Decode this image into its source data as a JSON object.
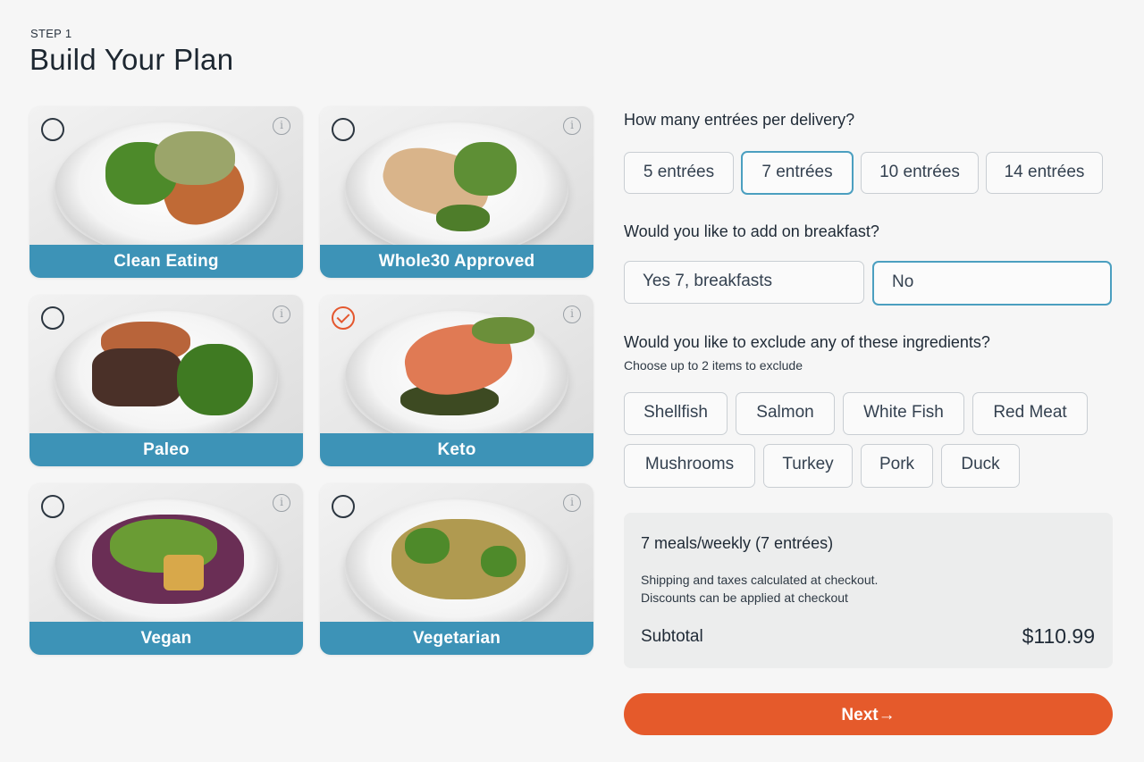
{
  "header": {
    "step": "STEP 1",
    "title": "Build Your Plan"
  },
  "plans": [
    {
      "label": "Clean Eating",
      "selected": false
    },
    {
      "label": "Whole30 Approved",
      "selected": false
    },
    {
      "label": "Paleo",
      "selected": false
    },
    {
      "label": "Keto",
      "selected": true
    },
    {
      "label": "Vegan",
      "selected": false
    },
    {
      "label": "Vegetarian",
      "selected": false
    }
  ],
  "entrees": {
    "question": "How many entrées per delivery?",
    "options": [
      "5 entrées",
      "7 entrées",
      "10 entrées",
      "14 entrées"
    ],
    "selected": "7 entrées"
  },
  "breakfast": {
    "question": "Would you like to add on breakfast?",
    "options": [
      "Yes 7, breakfasts",
      "No"
    ],
    "selected": "No"
  },
  "exclude": {
    "question": "Would you like to exclude any of these ingredients?",
    "hint": "Choose up to 2 items to exclude",
    "options": [
      "Shellfish",
      "Salmon",
      "White Fish",
      "Red Meat",
      "Mushrooms",
      "Turkey",
      "Pork",
      "Duck"
    ]
  },
  "summary": {
    "title": "7 meals/weekly (7 entrées)",
    "note1": "Shipping and taxes calculated at checkout.",
    "note2": "Discounts can be applied at checkout",
    "subtotal_label": "Subtotal",
    "subtotal_value": "$110.99"
  },
  "next": {
    "label": "Next→"
  },
  "colors": {
    "accent": "#e55a2b",
    "plan_bar": "#3d93b7",
    "selected_border": "#4b9fc0",
    "summary_bg": "#eceded"
  },
  "icons": {
    "radio": "radio-circle-icon",
    "checked": "check-circle-icon",
    "info": "info-icon"
  }
}
